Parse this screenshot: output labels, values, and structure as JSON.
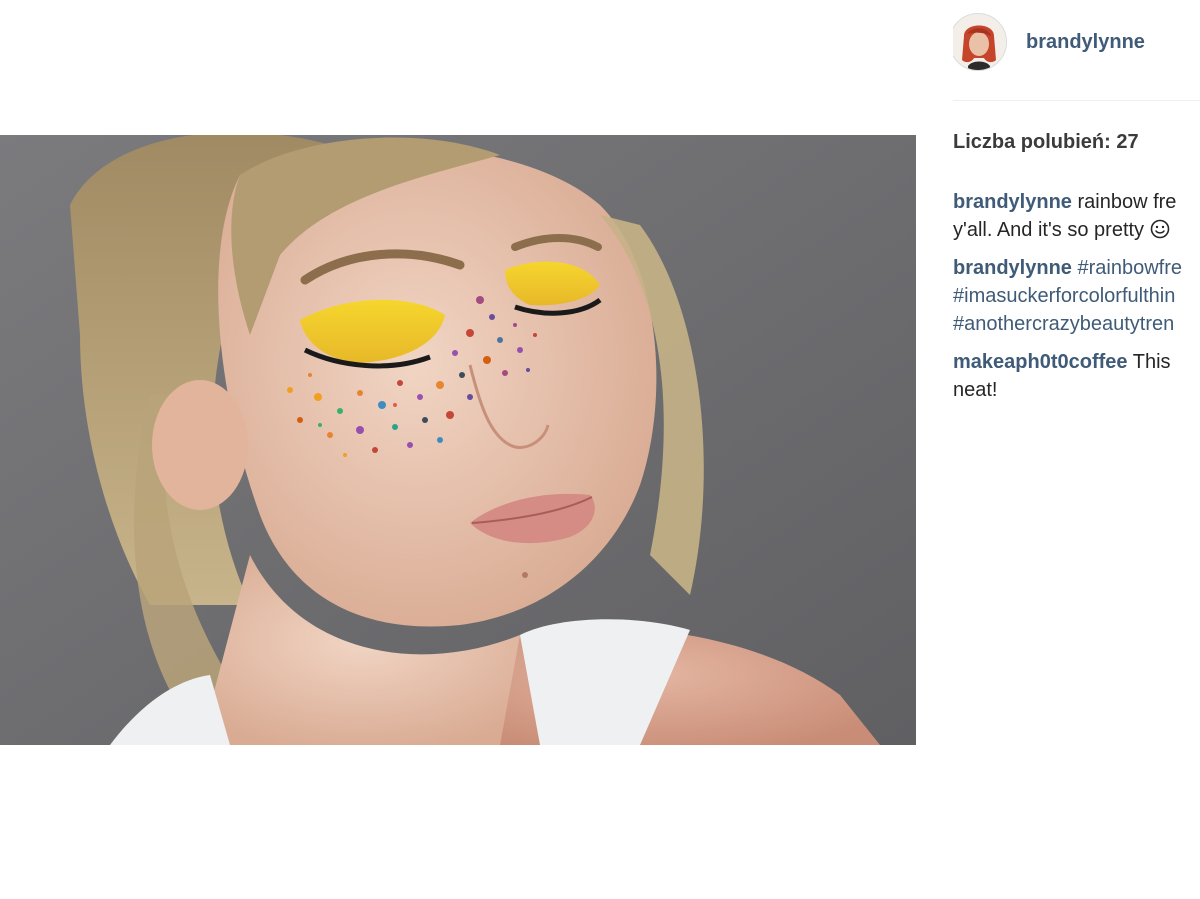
{
  "header": {
    "username": "brandylynne"
  },
  "likes_text": "Liczba polubień: 27",
  "comments": [
    {
      "user": "brandylynne",
      "line1": "rainbow fre",
      "line2": "y'all. And it's so pretty",
      "emoji": "smiley-icon"
    },
    {
      "user": "brandylynne",
      "tags": [
        "#rainbowfre",
        "#imasuckerforcolorfulthin",
        "#anothercrazybeautytren"
      ]
    },
    {
      "user": "makeaph0t0coffee",
      "line1": "This",
      "line2": "neat!"
    }
  ],
  "colors": {
    "link": "#3f5b78",
    "text": "#262626",
    "likes": "#3b3b3b",
    "divider": "#efefef",
    "photo_background": "#6f6f72",
    "eyeshadow": "#f3cf2a"
  },
  "icons": [
    "avatar-photo",
    "smiley-icon"
  ]
}
